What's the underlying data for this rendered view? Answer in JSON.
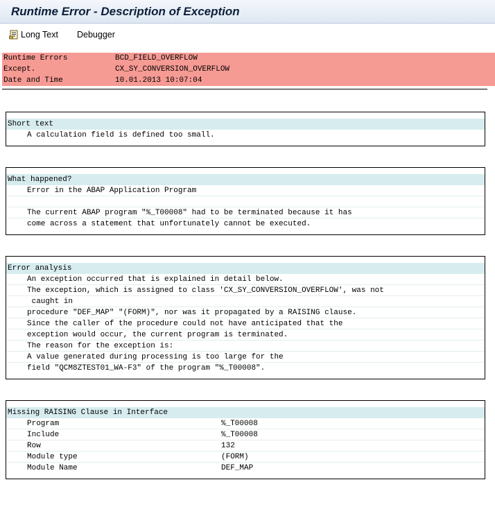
{
  "window": {
    "title": "Runtime Error - Description of Exception"
  },
  "toolbar": {
    "long_text_label": "Long Text",
    "long_text_icon": "document-text-icon",
    "debugger_label": "Debugger"
  },
  "header": {
    "rows": [
      {
        "key": "Runtime Errors",
        "value": "BCD_FIELD_OVERFLOW"
      },
      {
        "key": "Except.",
        "value": "CX_SY_CONVERSION_OVERFLOW"
      },
      {
        "key": "Date and Time",
        "value": "10.01.2013 10:07:04"
      }
    ],
    "color": "#f69a94"
  },
  "sections": {
    "short_text": {
      "title": "Short text",
      "lines": [
        "A calculation field is defined too small."
      ]
    },
    "what_happened": {
      "title": "What happened?",
      "lines": [
        "Error in the ABAP Application Program",
        "",
        "The current ABAP program \"%_T00008\" had to be terminated because it has",
        "come across a statement that unfortunately cannot be executed."
      ]
    },
    "error_analysis": {
      "title": "Error analysis",
      "lines": [
        "An exception occurred that is explained in detail below.",
        "The exception, which is assigned to class 'CX_SY_CONVERSION_OVERFLOW', was not",
        " caught in",
        "procedure \"DEF_MAP\" \"(FORM)\", nor was it propagated by a RAISING clause.",
        "Since the caller of the procedure could not have anticipated that the",
        "exception would occur, the current program is terminated.",
        "The reason for the exception is:",
        "A value generated during processing is too large for the",
        "field \"QCM8ZTEST01_WA-F3\" of the program \"%_T00008\"."
      ]
    },
    "missing_raising": {
      "title": "Missing RAISING Clause in Interface",
      "rows": [
        {
          "key": "Program",
          "value": "%_T00008"
        },
        {
          "key": "Include",
          "value": "%_T00008"
        },
        {
          "key": "Row",
          "value": "132"
        },
        {
          "key": "Module type",
          "value": "(FORM)"
        },
        {
          "key": "Module Name",
          "value": "DEF_MAP"
        }
      ]
    }
  },
  "colors": {
    "section_header": "#d7ecef",
    "title_text": "#0d1f3a"
  }
}
